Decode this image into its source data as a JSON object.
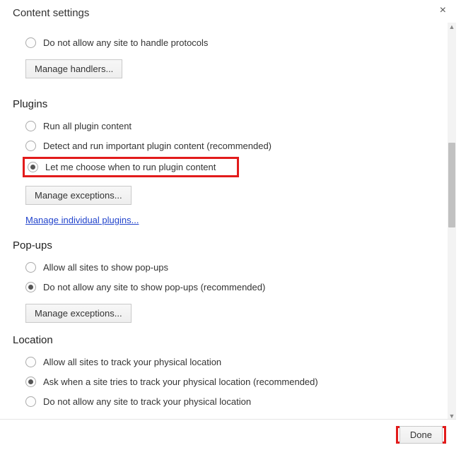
{
  "dialog": {
    "title": "Content settings",
    "close": "×",
    "done": "Done"
  },
  "handlers": {
    "opt_block": "Do not allow any site to handle protocols",
    "manage": "Manage handlers..."
  },
  "plugins": {
    "heading": "Plugins",
    "opt_run_all": "Run all plugin content",
    "opt_detect": "Detect and run important plugin content (recommended)",
    "opt_choose": "Let me choose when to run plugin content",
    "manage_exceptions": "Manage exceptions...",
    "manage_individual": "Manage individual plugins..."
  },
  "popups": {
    "heading": "Pop-ups",
    "opt_allow": "Allow all sites to show pop-ups",
    "opt_block": "Do not allow any site to show pop-ups (recommended)",
    "manage_exceptions": "Manage exceptions..."
  },
  "location": {
    "heading": "Location",
    "opt_allow": "Allow all sites to track your physical location",
    "opt_ask": "Ask when a site tries to track your physical location (recommended)",
    "opt_block": "Do not allow any site to track your physical location"
  }
}
